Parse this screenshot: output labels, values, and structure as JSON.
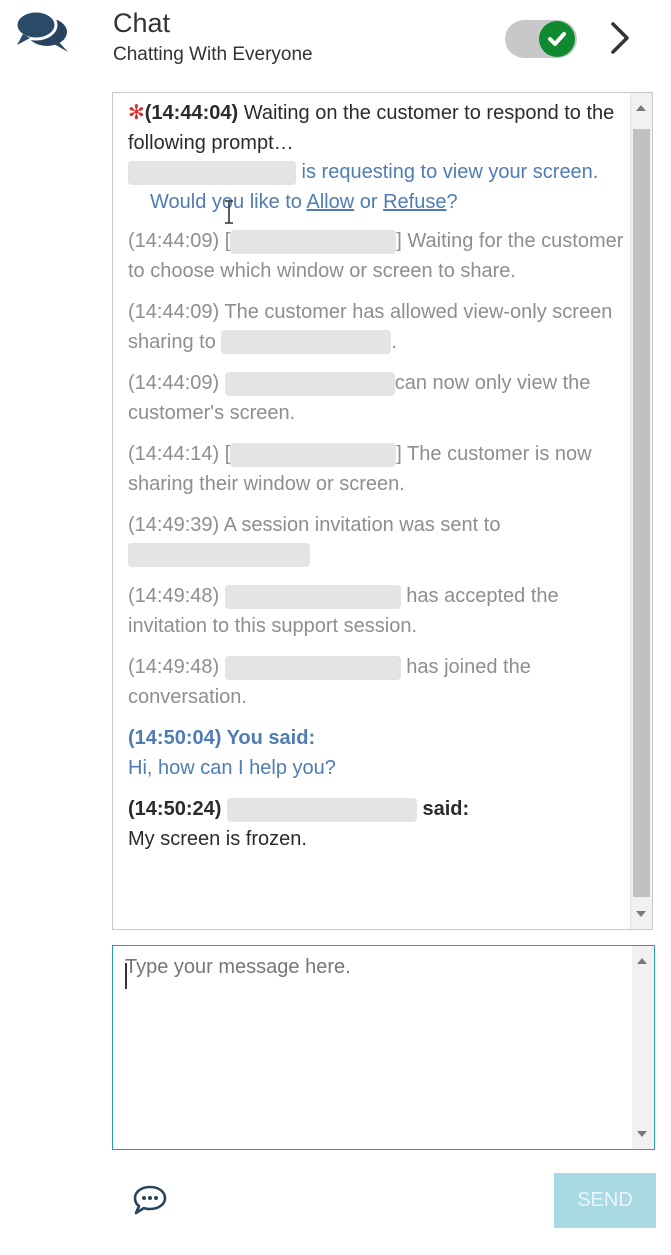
{
  "header": {
    "title": "Chat",
    "subtitle": "Chatting With Everyone",
    "toggle_state": "on",
    "toggle_color": "#108a2e"
  },
  "messages": {
    "m1": {
      "time": "(14:44:04)",
      "text": " Waiting on the customer to respond to the following prompt…",
      "request": " is requesting to view your screen.",
      "question_pre": "Would you like to ",
      "allow": "Allow",
      "or": " or ",
      "refuse": "Refuse",
      "question_end": "?"
    },
    "m2": {
      "time": "(14:44:09)",
      "pre": " [",
      "post": "] Waiting for the customer to choose which window or screen to share."
    },
    "m3": {
      "time": "(14:44:09)",
      "text": " The customer has allowed view-only screen sharing to ",
      "end": "."
    },
    "m4": {
      "time": "(14:44:09) ",
      "text": "can now only view the customer's screen."
    },
    "m5": {
      "time": "(14:44:14)",
      "pre": " [",
      "post": "] The customer is now sharing their window or screen."
    },
    "m6": {
      "time": "(14:49:39)",
      "text": " A session invitation was sent to"
    },
    "m7": {
      "time": "(14:49:48) ",
      "text": " has accepted the invitation to this support session."
    },
    "m8": {
      "time": "(14:49:48) ",
      "text": " has joined the conversation."
    },
    "m9": {
      "header": "(14:50:04) You said:",
      "text": "Hi, how can I help you?"
    },
    "m10": {
      "time": "(14:50:24) ",
      "said": " said:",
      "text": "My screen is frozen."
    }
  },
  "input": {
    "placeholder": "Type your message here."
  },
  "footer": {
    "send_label": "SEND"
  },
  "colors": {
    "accent": "#2a9bb3",
    "send_bg": "#a9d9e2",
    "message_blue": "#4f7cb5",
    "system_gray": "#8e8e8e",
    "alert_red": "#d32f2f"
  },
  "icons": [
    "chat-bubbles-icon",
    "check-icon",
    "chevron-right-icon",
    "text-cursor-icon",
    "chat-bubble-dots-icon"
  ]
}
